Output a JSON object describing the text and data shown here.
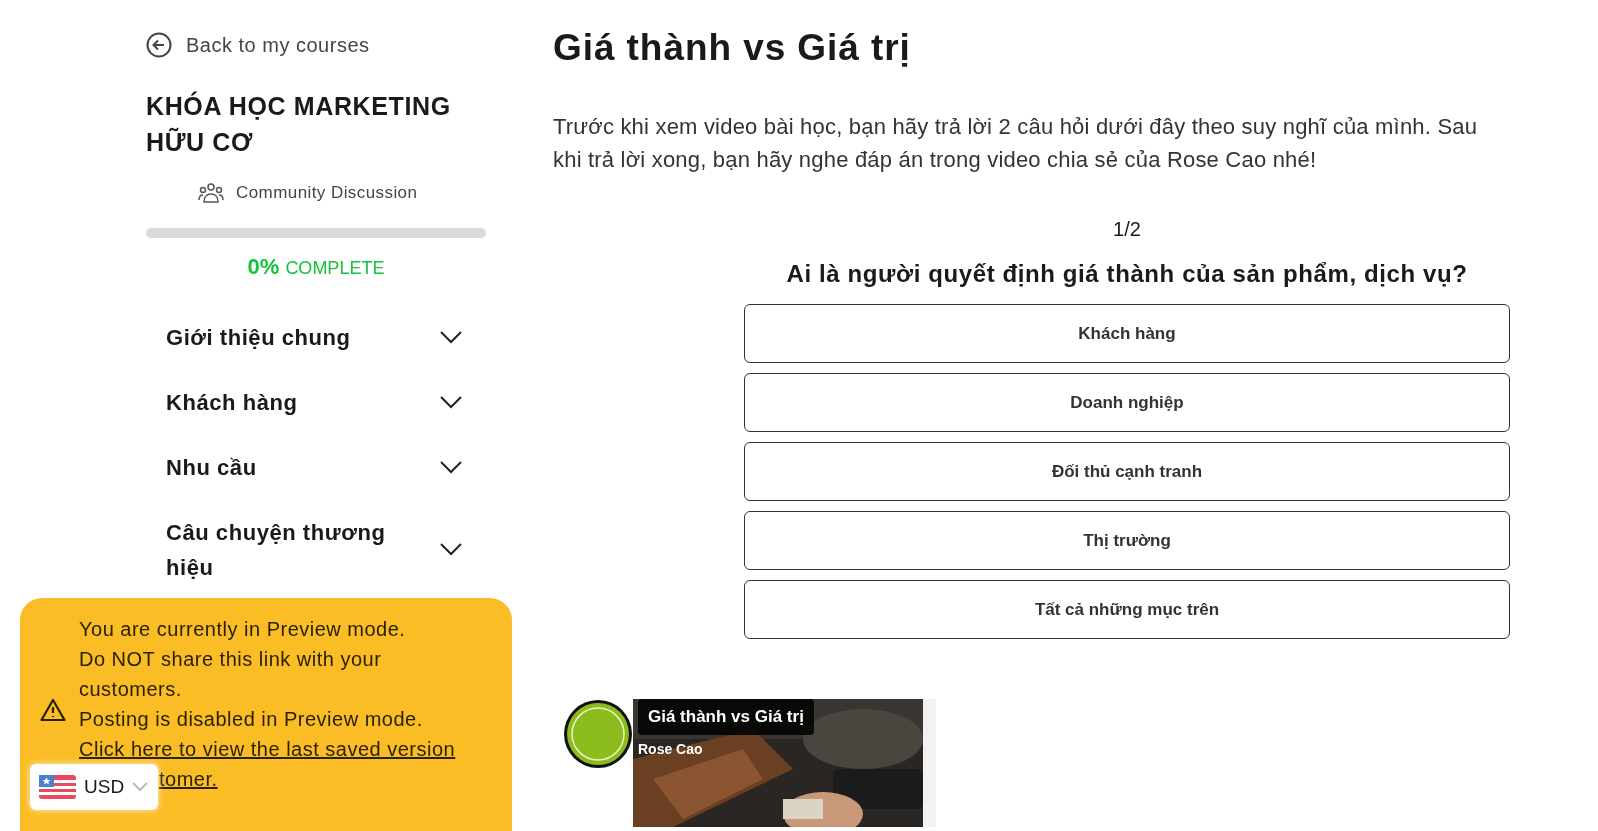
{
  "sidebar": {
    "back_link": "Back to my courses",
    "course_title": "KHÓA HỌC MARKETING HỮU CƠ",
    "community_link": "Community Discussion",
    "progress": {
      "level": 0,
      "percent": "0%",
      "label": "COMPLETE"
    },
    "sections": [
      {
        "title": "Giới thiệu chung",
        "expanded": false
      },
      {
        "title": "Khách hàng",
        "expanded": false
      },
      {
        "title": "Nhu cầu",
        "expanded": false
      },
      {
        "title": "Câu chuyện thương hiệu",
        "expanded": false
      }
    ]
  },
  "preview_banner": {
    "lines": [
      "You are currently in Preview mode.",
      "Do NOT share this link with your customers.",
      "Posting is disabled in Preview mode."
    ],
    "link_line": "Click here to view the last saved version",
    "link_tail": "tomer."
  },
  "currency_selector": {
    "value": "USD"
  },
  "lesson": {
    "title": "Giá thành vs Giá trị",
    "intro": "Trước khi xem video bài học, bạn hãy trả lời 2 câu hỏi dưới đây theo suy nghĩ của mình. Sau khi trả lời xong, bạn hãy nghe đáp án trong video chia sẻ của Rose Cao nhé!",
    "quiz": {
      "counter": "1/2",
      "question": "Ai là người quyết định giá thành của sản phẩm, dịch vụ?",
      "options": [
        {
          "label": "Khách hàng",
          "selected": false
        },
        {
          "label": "Doanh nghiệp",
          "selected": false
        },
        {
          "label": "Đối thủ cạnh tranh",
          "selected": false
        },
        {
          "label": "Thị trường",
          "selected": false
        },
        {
          "label": "Tất cả những mục trên",
          "selected": false
        }
      ]
    },
    "video": {
      "title": "Giá thành vs Giá trị",
      "channel": "Rose Cao"
    }
  }
}
